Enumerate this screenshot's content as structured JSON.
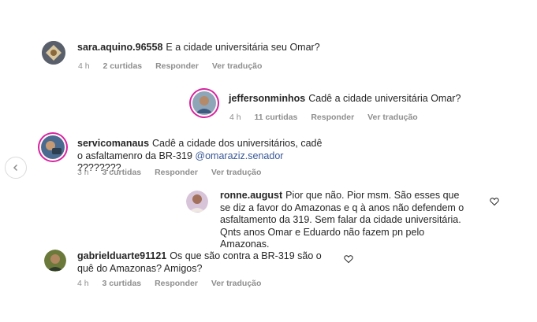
{
  "nav": {
    "prev_icon": "chevron-left-icon"
  },
  "comments": [
    {
      "username": "sara.aquino.96558",
      "text": "E a cidade universitária seu Omar?",
      "time": "4 h",
      "likes": "2 curtidas",
      "reply": "Responder",
      "translate": "Ver tradução"
    },
    {
      "username": "jeffersonminhos",
      "text": "Cadê a cidade universitária Omar?",
      "time": "4 h",
      "likes": "11 curtidas",
      "reply": "Responder",
      "translate": "Ver tradução"
    },
    {
      "username": "servicomanaus",
      "text_before": "Cadê a cidade dos universitários, cadê o asfaltamenro da BR-319",
      "mention": "@omaraziz.senador",
      "text_after": "????????",
      "time": "3 h",
      "likes": "3 curtidas",
      "reply": "Responder",
      "translate": "Ver tradução"
    },
    {
      "username": "ronne.august",
      "text": "Pior que não. Pior msm. São esses que se diz a favor do Amazonas e q à anos não defendem o asfaltamento da 319. Sem falar da cidade universitária. Qnts anos Omar e Eduardo não fazem pn pelo Amazonas."
    },
    {
      "username": "gabrielduarte91121",
      "text": "Os que são contra a BR-319 são o quê do Amazonas? Amigos?",
      "time": "4 h",
      "likes": "3 curtidas",
      "reply": "Responder",
      "translate": "Ver tradução"
    }
  ]
}
